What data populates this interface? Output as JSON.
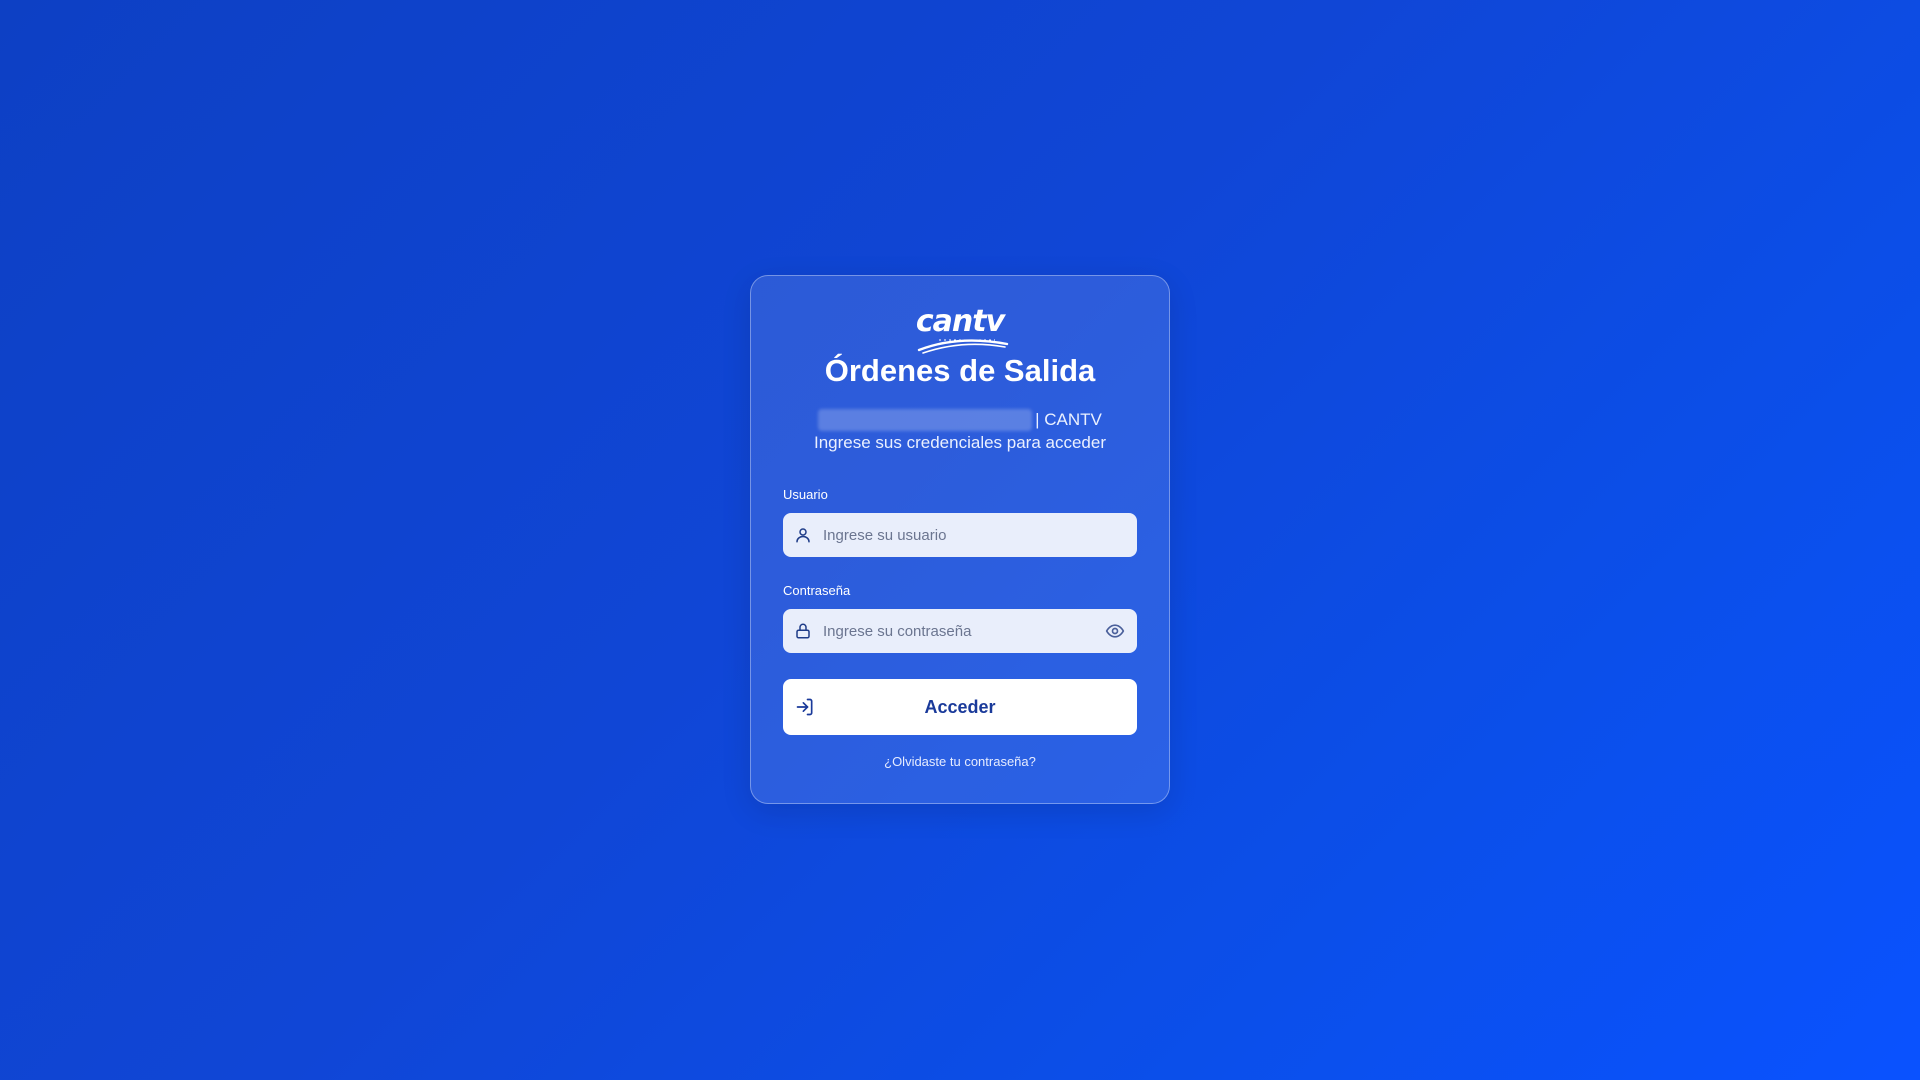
{
  "brand": {
    "logo_text": "cantv",
    "logo_icon": "cantv-logo"
  },
  "card": {
    "title": "Órdenes de Salida",
    "subtitle_suffix": "| CANTV",
    "subtitle_line2": "Ingrese sus credenciales para acceder"
  },
  "form": {
    "username": {
      "label": "Usuario",
      "placeholder": "Ingrese su usuario",
      "value": "",
      "icon": "user-icon"
    },
    "password": {
      "label": "Contraseña",
      "placeholder": "Ingrese su contraseña",
      "value": "",
      "icon": "lock-icon",
      "toggle_icon": "eye-icon"
    },
    "submit": {
      "label": "Acceder",
      "icon": "sign-in-icon"
    },
    "forgot_link": "¿Olvidaste tu contraseña?"
  },
  "colors": {
    "background_start": "#0d40c4",
    "background_end": "#0a52ff",
    "button_text": "#1a3a9a",
    "input_bg": "#e9eefb"
  }
}
